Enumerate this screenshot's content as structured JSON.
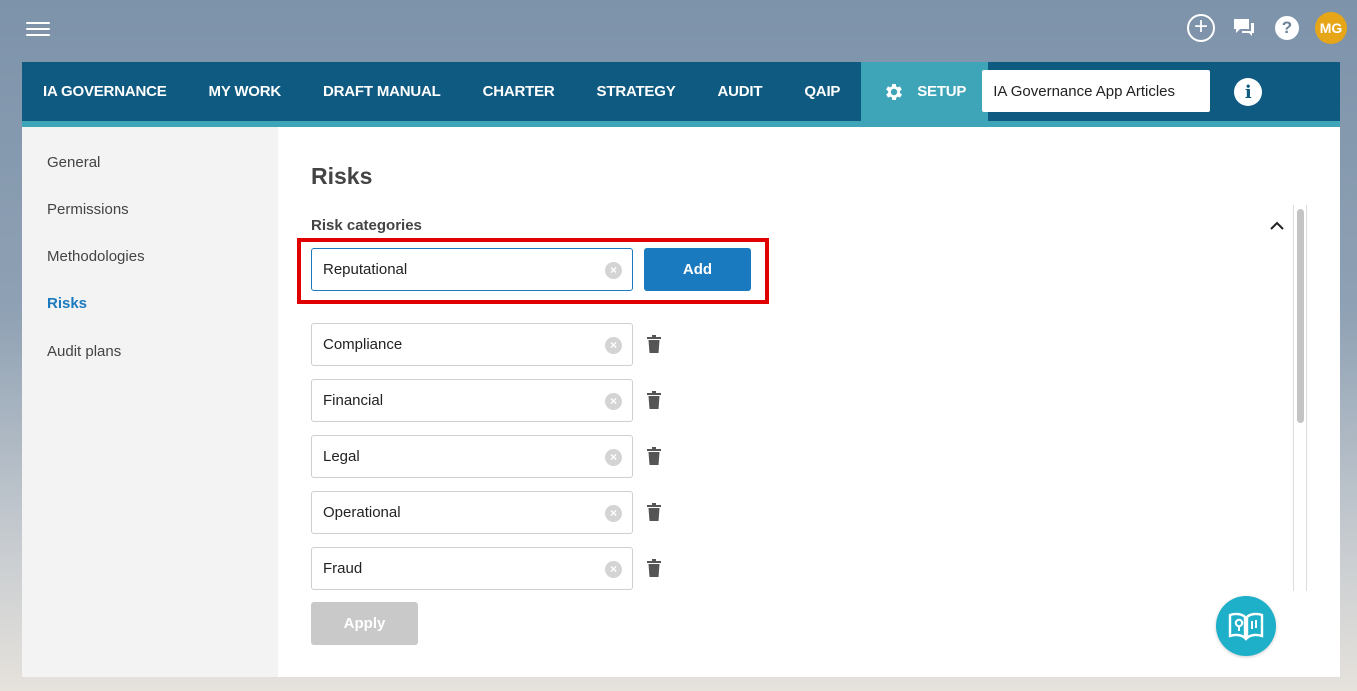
{
  "topbar": {
    "icons": [
      "menu-icon",
      "plus-circle-icon",
      "chat-icon",
      "help-icon"
    ],
    "avatar_initials": "MG",
    "avatar_color": "#e6a617"
  },
  "nav": {
    "tabs": [
      {
        "label": "IA GOVERNANCE"
      },
      {
        "label": "MY WORK"
      },
      {
        "label": "DRAFT MANUAL"
      },
      {
        "label": "CHARTER"
      },
      {
        "label": "STRATEGY"
      },
      {
        "label": "AUDIT"
      },
      {
        "label": "QAIP"
      }
    ],
    "setup_label": "SETUP",
    "search_value": "IA Governance App Articles",
    "info_label": "i",
    "colors": {
      "nav_bg": "#0f5a80",
      "active_bg": "#3ea4b8"
    }
  },
  "sidebar": {
    "items": [
      {
        "label": "General"
      },
      {
        "label": "Permissions"
      },
      {
        "label": "Methodologies"
      },
      {
        "label": "Risks"
      },
      {
        "label": "Audit plans"
      }
    ],
    "active": "Risks"
  },
  "main": {
    "title": "Risks",
    "section_title": "Risk categories",
    "new_category_value": "Reputational",
    "add_label": "Add",
    "categories": [
      {
        "value": "Compliance"
      },
      {
        "value": "Financial"
      },
      {
        "value": "Legal"
      },
      {
        "value": "Operational"
      },
      {
        "value": "Fraud"
      }
    ],
    "apply_label": "Apply",
    "clear_symbol": "×"
  }
}
